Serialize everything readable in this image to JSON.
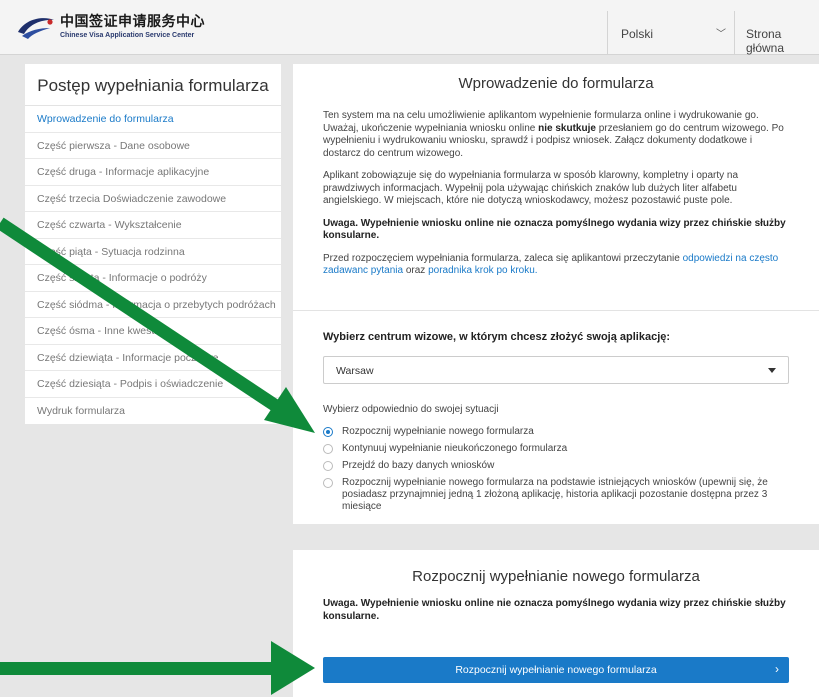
{
  "header": {
    "logo_cn": "中国签证申请服务中心",
    "logo_en": "Chinese Visa Application Service Center",
    "language": "Polski",
    "home": "Strona główna"
  },
  "sidebar": {
    "title": "Postęp wypełniania formularza",
    "items": [
      {
        "label": "Wprowadzenie do formularza"
      },
      {
        "label": "Część pierwsza - Dane osobowe"
      },
      {
        "label": "Część druga - Informacje aplikacyjne"
      },
      {
        "label": "Część trzecia   Doświadczenie zawodowe"
      },
      {
        "label": "Część czwarta - Wykształcenie"
      },
      {
        "label": "Część piąta - Sytuacja rodzinna"
      },
      {
        "label": "Część szósta - Informacje o podróży"
      },
      {
        "label": "Część siódma - Informacja o przebytych podróżach"
      },
      {
        "label": "Część ósma - Inne kwestie"
      },
      {
        "label": "Część dziewiąta - Informacje pocztowe"
      },
      {
        "label": "Część dziesiąta - Podpis i oświadczenie"
      },
      {
        "label": "Wydruk formularza"
      }
    ]
  },
  "intro": {
    "title": "Wprowadzenie do formularza",
    "p1_a": "Ten system ma na celu umożliwienie aplikantom wypełnienie formularza online i wydrukowanie go. Uważaj, ukończenie wypełniania wniosku online ",
    "p1_bold": "nie skutkuje",
    "p1_b": " przesłaniem go do centrum wizowego. Po wypełnieniu i wydrukowaniu wniosku, sprawdź i podpisz wniosek. Załącz dokumenty dodatkowe i dostarcz do centrum wizowego.",
    "p2": "Aplikant zobowiązuje się do wypełniania formularza w sposób klarowny, kompletny i oparty na prawdziwych informacjach. Wypełnij pola używając chińskich znaków lub dużych liter alfabetu angielskiego. W miejscach, które nie dotyczą wnioskodawcy, możesz pozostawić puste pole.",
    "warning": "Uwaga. Wypełnienie wniosku online nie oznacza pomyślnego wydania wizy przez chińskie służby konsularne.",
    "p4_a": "Przed rozpoczęciem wypełniania formularza, zaleca się aplikantowi przeczytanie ",
    "p4_link1": "odpowiedzi na często zadawanc pytania",
    "p4_mid": " oraz ",
    "p4_link2": "poradnika krok po kroku."
  },
  "center": {
    "label": "Wybierz centrum wizowe, w którym chcesz złożyć swoją aplikację:",
    "selected": "Warsaw",
    "situation_label": "Wybierz odpowiednio do swojej sytuacji",
    "options": [
      {
        "label": "Rozpocznij wypełnianie nowego formularza",
        "checked": true
      },
      {
        "label": "Kontynuuj wypełnianie nieukończonego formularza",
        "checked": false
      },
      {
        "label": "Przejdź do bazy danych wniosków",
        "checked": false
      },
      {
        "label": "Rozpocznij wypełnianie nowego formularza na podstawie istniejących wniosków (upewnij się, że posiadasz przynajmniej jedną 1 złożoną aplikację, historia aplikacji pozostanie dostępna przez 3 miesiące",
        "checked": false
      }
    ]
  },
  "start": {
    "title": "Rozpocznij wypełnianie nowego formularza",
    "warning": "Uwaga. Wypełnienie wniosku online nie oznacza pomyślnego wydania wizy przez chińskie służby konsularne.",
    "button": "Rozpocznij wypełnianie nowego formularza"
  },
  "colors": {
    "accent": "#1a7ac8",
    "annotation_arrow": "#0f8a3a"
  }
}
